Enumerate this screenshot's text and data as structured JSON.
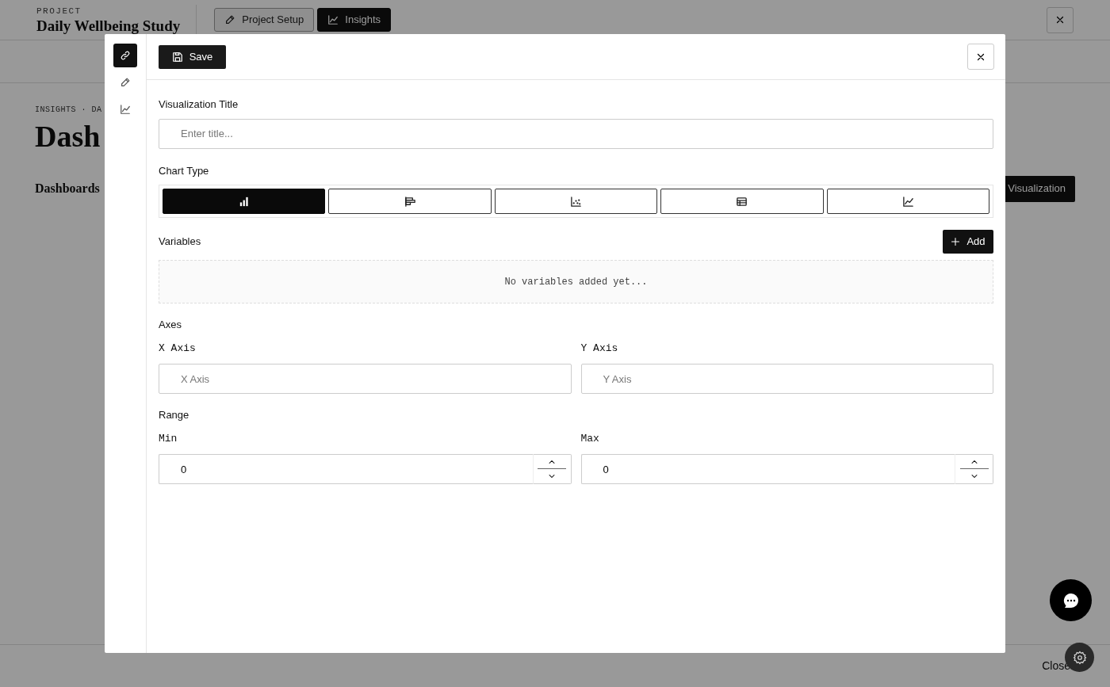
{
  "background": {
    "project_label": "PROJECT",
    "project_title": "Daily Wellbeing Study",
    "nav_tabs": [
      {
        "label": "Project Setup",
        "kind": "pencil",
        "selected": false
      },
      {
        "label": "Insights",
        "kind": "chart",
        "selected": true
      }
    ],
    "breadcrumb": "INSIGHTS · DA",
    "heading": "Dash",
    "section_title": "Dashboards",
    "new_button": "Visualization",
    "footer_close": "Close"
  },
  "modal": {
    "rail": [
      {
        "kind": "link",
        "selected": true
      },
      {
        "kind": "pencil",
        "selected": false
      },
      {
        "kind": "chart",
        "selected": false
      }
    ],
    "save_button": "Save",
    "title_label": "Visualization Title",
    "title_placeholder": "Enter title...",
    "chart_type_label": "Chart Type",
    "chart_types": [
      {
        "kind": "bar",
        "selected": true
      },
      {
        "kind": "hbar",
        "selected": false
      },
      {
        "kind": "scatter",
        "selected": false
      },
      {
        "kind": "table",
        "selected": false
      },
      {
        "kind": "line",
        "selected": false
      }
    ],
    "variables_label": "Variables",
    "add_button": "Add",
    "variables_empty": "No variables added yet...",
    "axes_label": "Axes",
    "axes": [
      {
        "label": "X Axis",
        "placeholder": "X Axis"
      },
      {
        "label": "Y Axis",
        "placeholder": "Y Axis"
      }
    ],
    "range_label": "Range",
    "range": [
      {
        "label": "Min",
        "value": "0"
      },
      {
        "label": "Max",
        "value": "0"
      }
    ]
  }
}
